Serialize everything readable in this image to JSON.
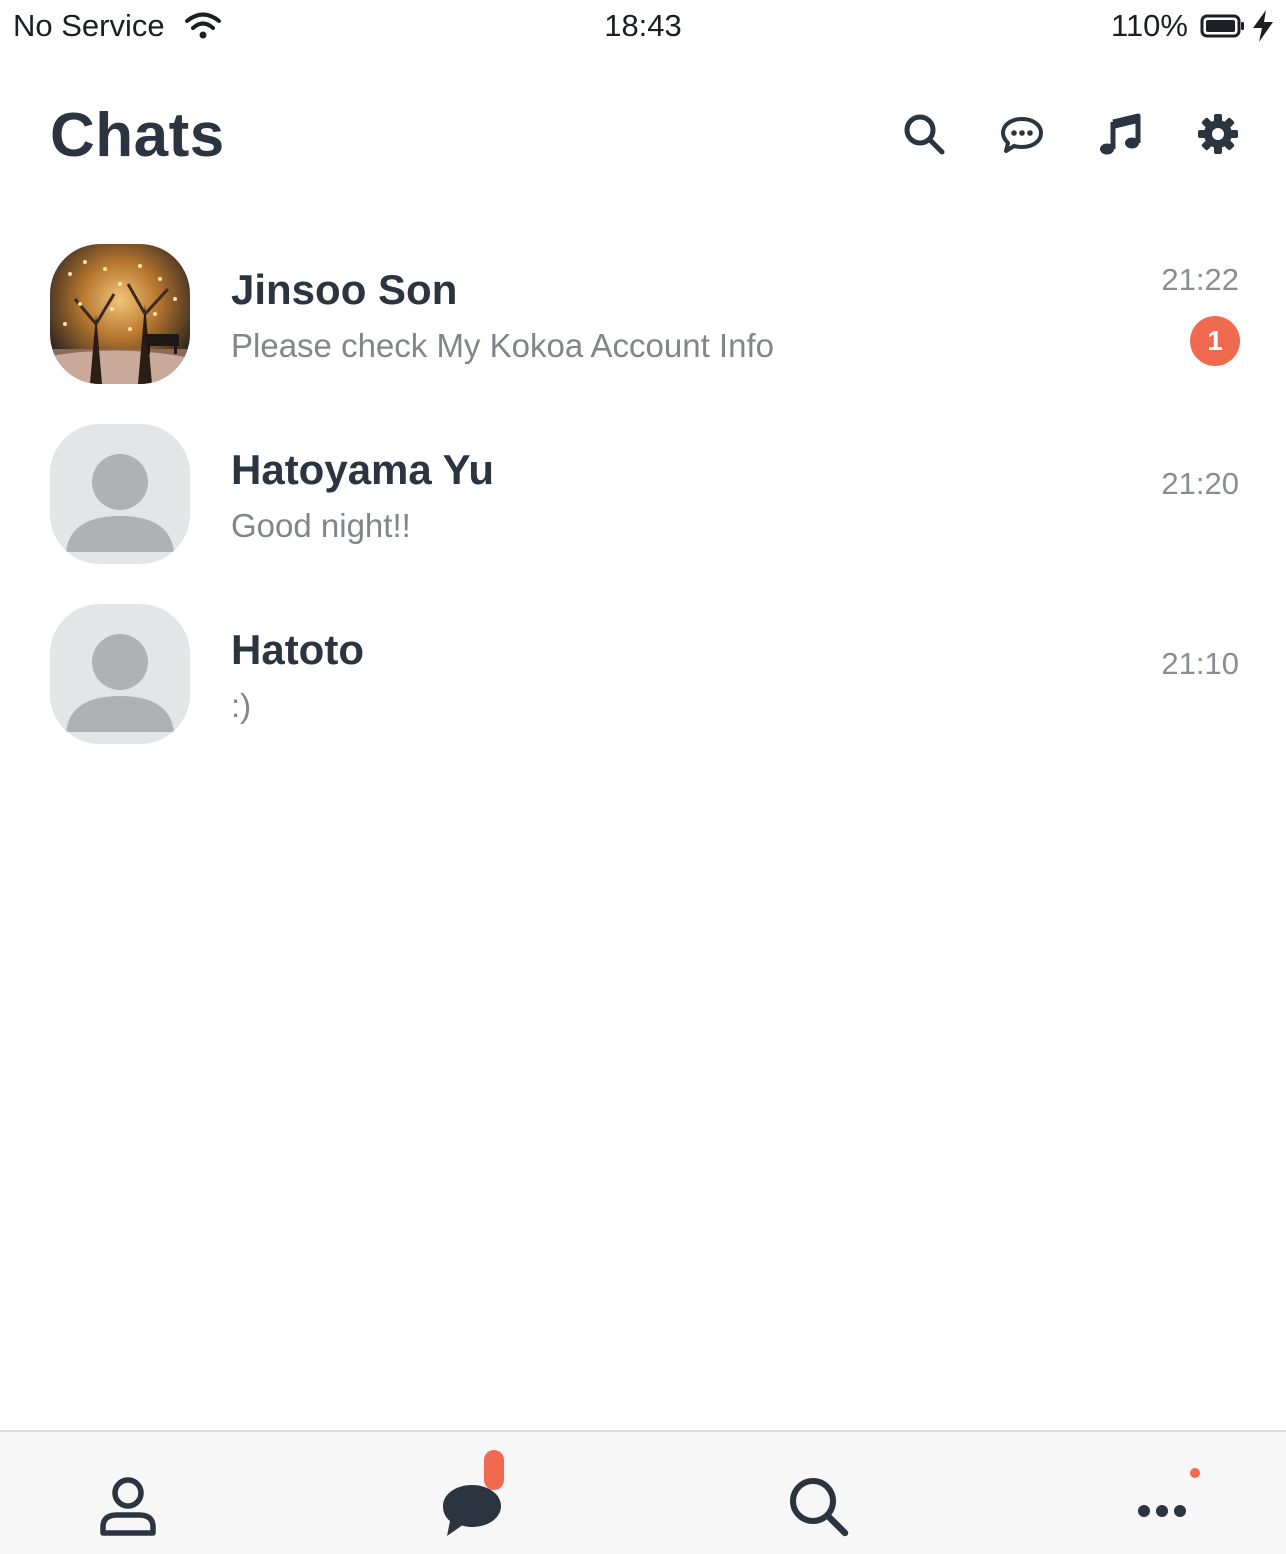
{
  "status_bar": {
    "carrier": "No Service",
    "time": "18:43",
    "battery": "110%"
  },
  "header": {
    "title": "Chats"
  },
  "chats": [
    {
      "name": "Jinsoo Son",
      "preview": "Please check My Kokoa Account Info",
      "time": "21:22",
      "unread": "1"
    },
    {
      "name": "Hatoyama Yu",
      "preview": "Good night!!",
      "time": "21:20"
    },
    {
      "name": "Hatoto",
      "preview": ":)",
      "time": "21:10"
    }
  ],
  "colors": {
    "accent": "#ef6a4e",
    "text_primary": "#2c3440",
    "text_secondary": "#828589"
  },
  "icons": {
    "header": [
      "search-icon",
      "new-chat-icon",
      "music-icon",
      "settings-icon"
    ],
    "tabs": [
      "person-icon",
      "chat-bubble-icon",
      "search-icon",
      "more-icon"
    ]
  }
}
